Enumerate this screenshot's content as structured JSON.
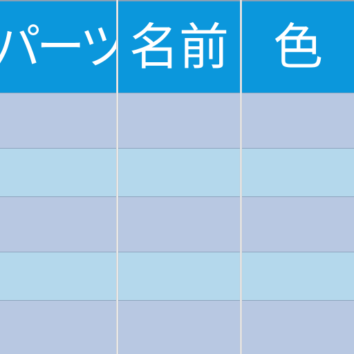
{
  "table": {
    "headers": [
      "パーツ",
      "名前",
      "色"
    ],
    "rows": [
      [
        "",
        "",
        ""
      ],
      [
        "",
        "",
        ""
      ],
      [
        "",
        "",
        ""
      ],
      [
        "",
        "",
        ""
      ],
      [
        "",
        "",
        ""
      ]
    ]
  },
  "colors": {
    "header_background": "#0b97dc",
    "header_text": "#ffffff",
    "row_odd": "#b8c8e2",
    "row_even": "#b4d8ec"
  }
}
